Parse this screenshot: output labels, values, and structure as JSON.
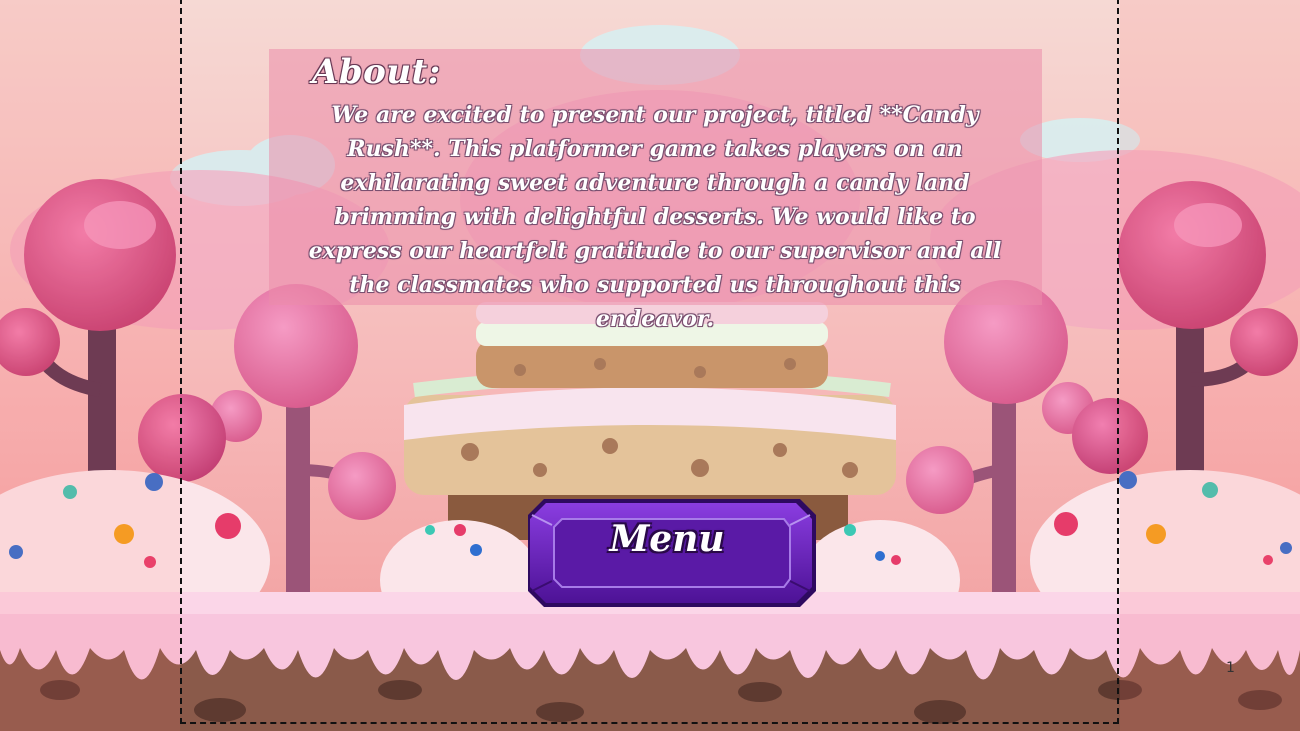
{
  "about": {
    "title": "About:",
    "body": "We are excited to present our project, titled **Candy Rush**. This platformer game takes players on an exhilarating sweet adventure through a candy land brimming with delightful desserts. We would like to express our heartfelt gratitude to our supervisor and all the classmates who supported us throughout this endeavor."
  },
  "menu_button": {
    "label": "Menu"
  },
  "page_number": "1",
  "colors": {
    "sky": "#f5c6c6",
    "pink_frosting": "#f8c6de",
    "lollipop": "#d2477c",
    "button_purple": "#6a1fb0",
    "dirt": "#8a5a4a"
  }
}
